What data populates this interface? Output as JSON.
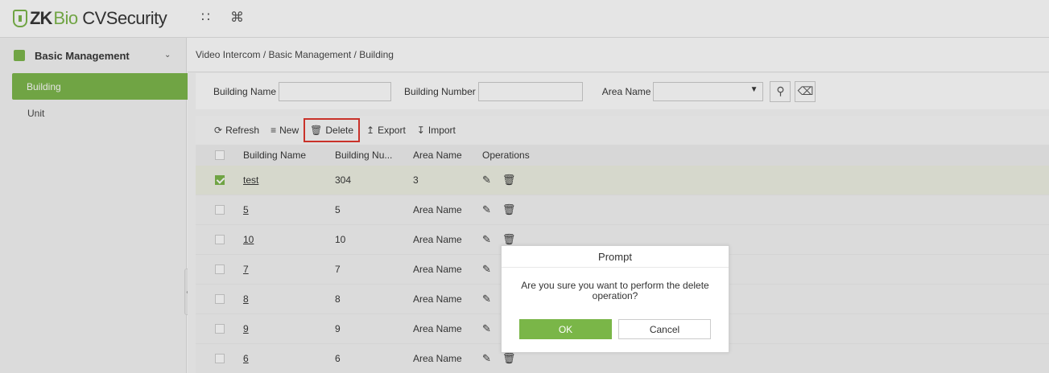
{
  "app": {
    "logo_brand": "ZK",
    "logo_product_green": "Bio",
    "logo_product_rest": "CVSecurity",
    "grid_icon": "apps-grid-icon",
    "command_icon": "command-icon"
  },
  "sidebar": {
    "group_label": "Basic Management",
    "group_icon": "building-icon",
    "items": [
      {
        "label": "Building",
        "active": true
      },
      {
        "label": "Unit",
        "active": false
      }
    ]
  },
  "breadcrumb": "Video Intercom / Basic Management / Building",
  "filters": {
    "building_name_label": "Building Name",
    "building_name_value": "",
    "building_number_label": "Building Number",
    "building_number_value": "",
    "area_name_label": "Area Name",
    "area_name_value": ""
  },
  "toolbar": {
    "refresh": "Refresh",
    "new": "New",
    "delete": "Delete",
    "export": "Export",
    "import": "Import"
  },
  "table": {
    "headers": [
      "Building Name",
      "Building Nu...",
      "Area Name",
      "Operations"
    ],
    "rows": [
      {
        "name": "test",
        "number": "304",
        "area": "3",
        "selected": true
      },
      {
        "name": "5",
        "number": "5",
        "area": "Area Name",
        "selected": false
      },
      {
        "name": "10",
        "number": "10",
        "area": "Area Name",
        "selected": false
      },
      {
        "name": "7",
        "number": "7",
        "area": "Area Name",
        "selected": false
      },
      {
        "name": "8",
        "number": "8",
        "area": "Area Name",
        "selected": false
      },
      {
        "name": "9",
        "number": "9",
        "area": "Area Name",
        "selected": false
      },
      {
        "name": "6",
        "number": "6",
        "area": "Area Name",
        "selected": false
      }
    ]
  },
  "modal": {
    "title": "Prompt",
    "message": "Are you sure you want to perform the delete operation?",
    "ok": "OK",
    "cancel": "Cancel"
  },
  "colors": {
    "accent": "#7ab648",
    "highlight_border": "#e0342b"
  }
}
